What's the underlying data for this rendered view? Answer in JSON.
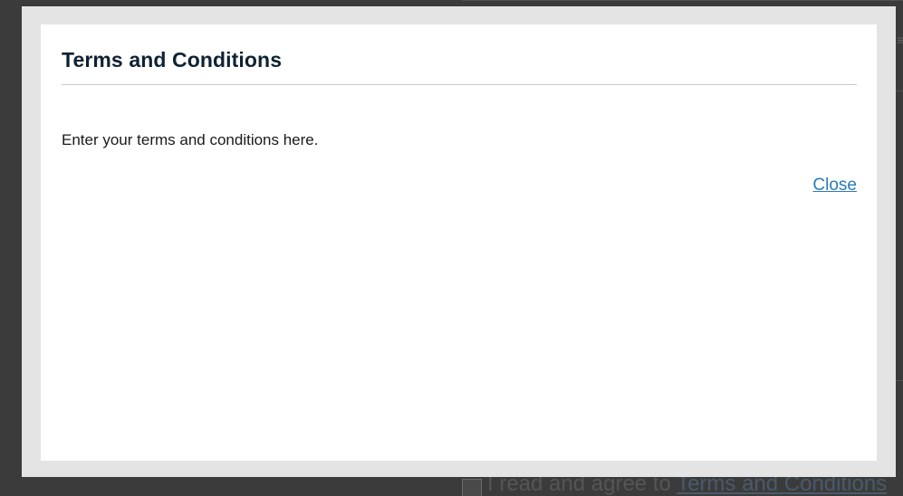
{
  "modal": {
    "title": "Terms and Conditions",
    "body_text": "Enter your terms and conditions here.",
    "close_label": "Close"
  },
  "background": {
    "agree_prefix": "I read and agree to ",
    "agree_link": "Terms and Conditions"
  },
  "colors": {
    "overlay": "#3b3b3b",
    "modal_frame": "#e4e4e4",
    "modal_body": "#ffffff",
    "title": "#0f2233",
    "link": "#2a7ab8"
  }
}
